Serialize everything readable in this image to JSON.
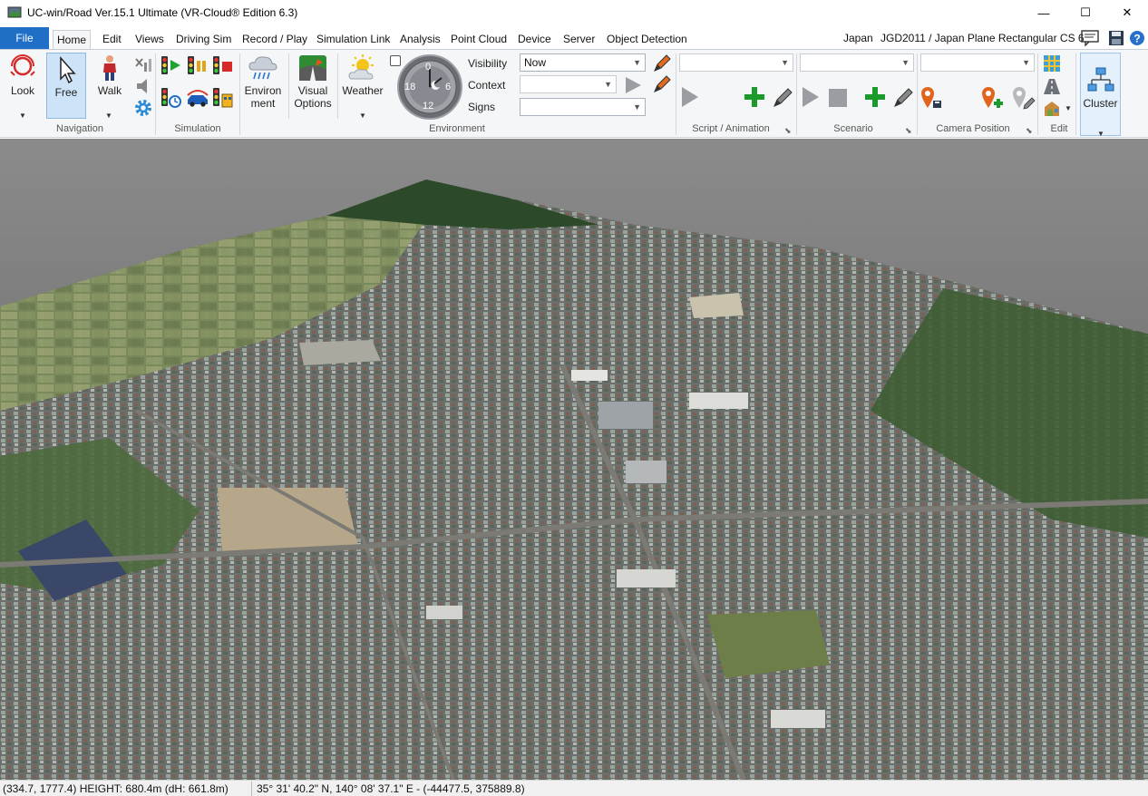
{
  "window": {
    "title": "UC-win/Road Ver.15.1 Ultimate (VR-Cloud® Edition 6.3)",
    "minimize": "—",
    "maximize": "☐",
    "close": "✕"
  },
  "tabs": [
    {
      "label": "File"
    },
    {
      "label": "Home"
    },
    {
      "label": "Edit"
    },
    {
      "label": "Views"
    },
    {
      "label": "Driving Sim"
    },
    {
      "label": "Record / Play"
    },
    {
      "label": "Simulation Link"
    },
    {
      "label": "Analysis"
    },
    {
      "label": "Point Cloud"
    },
    {
      "label": "Device"
    },
    {
      "label": "Server"
    },
    {
      "label": "Object Detection"
    }
  ],
  "header_info": {
    "region": "Japan",
    "crs": "JGD2011 / Japan Plane Rectangular CS 6"
  },
  "ribbon": {
    "navigation": {
      "label": "Navigation",
      "look": "Look",
      "free": "Free",
      "walk": "Walk"
    },
    "simulation": {
      "label": "Simulation"
    },
    "environment": {
      "label": "Environment",
      "environment_btn": "Environ\nment",
      "visual_options": "Visual\nOptions",
      "weather": "Weather",
      "clock": {
        "top": "0",
        "right": "6",
        "bottom": "12",
        "left": "18"
      },
      "visibility_label": "Visibility",
      "visibility_value": "Now",
      "context_label": "Context",
      "context_value": "",
      "signs_label": "Signs",
      "signs_value": ""
    },
    "script": {
      "label": "Script / Animation",
      "value": ""
    },
    "scenario": {
      "label": "Scenario",
      "value": ""
    },
    "camera": {
      "label": "Camera Position",
      "value": ""
    },
    "edit": {
      "label": "Edit"
    },
    "cluster": {
      "label": "Cluster"
    }
  },
  "status": {
    "position": "(334.7, 1777.4)  HEIGHT: 680.4m (dH: 661.8m)",
    "geo": "35° 31' 40.2\" N, 140° 08' 37.1\" E  -  (-44477.5, 375889.8)"
  },
  "colors": {
    "file_tab": "#1f6fc6",
    "ribbon_bg": "#f5f6f7",
    "add_green": "#1a9a2a",
    "pin_orange": "#e0641c"
  }
}
